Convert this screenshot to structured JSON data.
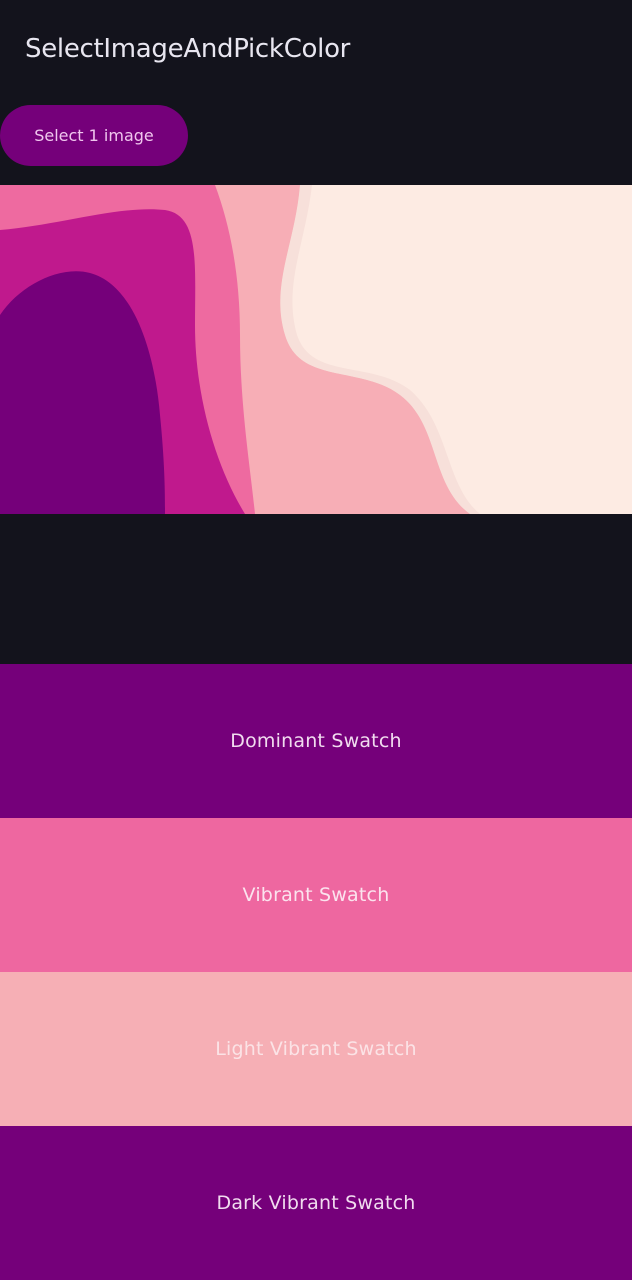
{
  "app": {
    "title": "SelectImageAndPickColor",
    "background": "#13131c"
  },
  "select_button": {
    "label": "Select 1 image",
    "color": "#75007a"
  },
  "selected_image": {
    "description_icon": "abstract-wave-image",
    "palette": [
      "#75007a",
      "#c0198d",
      "#ee6aa0",
      "#f7b0b4",
      "#fdebe3"
    ]
  },
  "swatches": [
    {
      "label": "Dominant Swatch",
      "color": "#75007a",
      "text_color": "#f1dcef"
    },
    {
      "label": "Vibrant Swatch",
      "color": "#ee67a0",
      "text_color": "#fbe3ee"
    },
    {
      "label": "Light Vibrant Swatch",
      "color": "#f6afb5",
      "text_color": "#fbe3e6"
    },
    {
      "label": "Dark Vibrant Swatch",
      "color": "#75007a",
      "text_color": "#f1dcef"
    }
  ]
}
